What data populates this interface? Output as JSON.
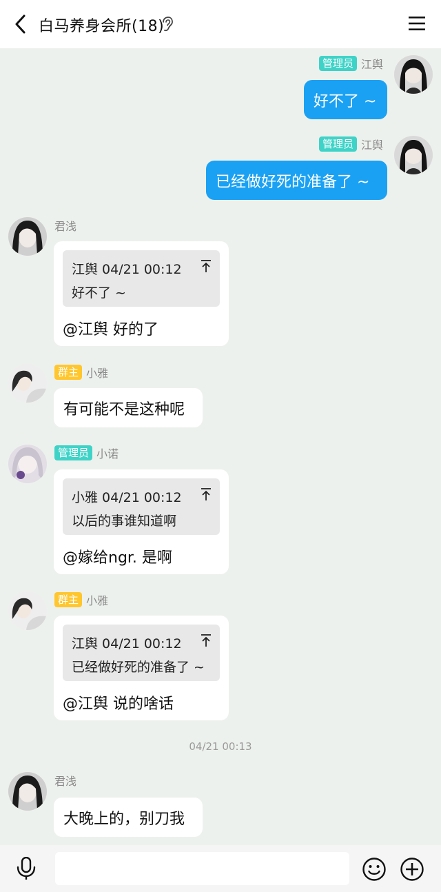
{
  "header": {
    "title": "白马养身会所(18)",
    "back_icon": "chevron-left-icon",
    "ear_icon": "ear-icon",
    "menu_icon": "hamburger-menu-icon"
  },
  "colors": {
    "outgoing_bubble": "#1aa1f4",
    "admin_badge": "#3fd3c8",
    "owner_badge": "#ffc62e",
    "chat_background": "#edf1ed"
  },
  "messages": [
    {
      "sender": "江舆",
      "badge": "管理员",
      "text": "好不了 ~",
      "direction": "out"
    },
    {
      "sender": "江舆",
      "badge": "管理员",
      "text": "已经做好死的准备了 ~",
      "direction": "out"
    },
    {
      "sender": "君浅",
      "badge": "",
      "quote_author_time": "江舆 04/21 00:12",
      "quote_text": "好不了 ~",
      "text": "@江舆 好的了",
      "direction": "in"
    },
    {
      "sender": "小雅",
      "badge": "群主",
      "text": "有可能不是这种呢",
      "direction": "in"
    },
    {
      "sender": "小诺",
      "badge": "管理员",
      "quote_author_time": "小雅 04/21 00:12",
      "quote_text": "以后的事谁知道啊",
      "text": "@嫁给ngr. 是啊",
      "direction": "in"
    },
    {
      "sender": "小雅",
      "badge": "群主",
      "quote_author_time": "江舆 04/21 00:12",
      "quote_text": "已经做好死的准备了 ~",
      "text": "@江舆 说的啥话",
      "direction": "in"
    },
    {
      "sender": "君浅",
      "badge": "",
      "text": "大晚上的，别刀我",
      "direction": "in"
    }
  ],
  "time_divider": "04/21 00:13",
  "input_bar": {
    "placeholder": "",
    "mic_icon": "microphone-icon",
    "emoji_icon": "smiley-icon",
    "plus_icon": "plus-circle-icon"
  }
}
